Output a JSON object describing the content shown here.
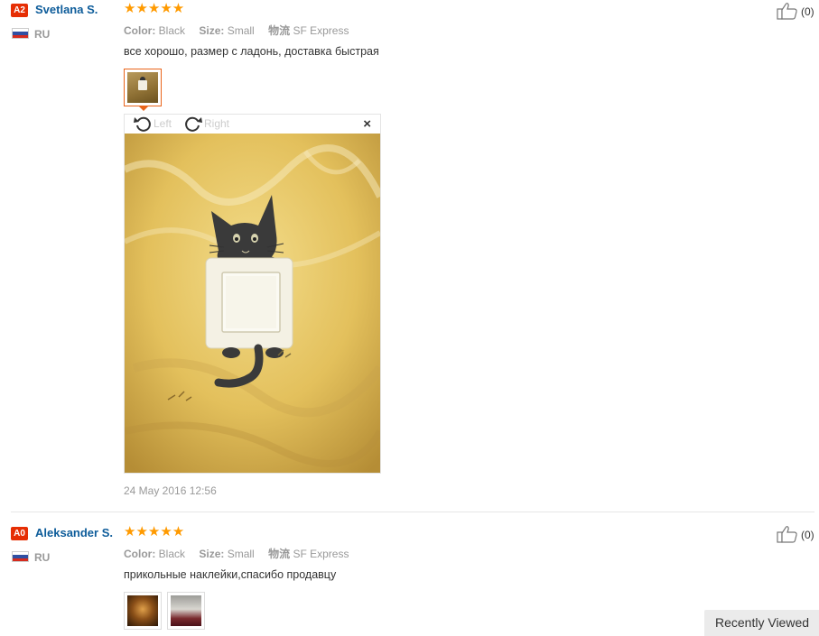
{
  "reviews": [
    {
      "level": "A2",
      "name": "Svetlana S.",
      "country": "RU",
      "stars": "★★★★★",
      "color_label": "Color:",
      "color_value": "Black",
      "size_label": "Size:",
      "size_value": "Small",
      "shipping_label": "物流",
      "shipping_value": "SF Express",
      "text": "все хорошо, размер с ладонь, доставка быстрая",
      "likes": "(0)",
      "date": "24 May 2016 12:56"
    },
    {
      "level": "A0",
      "name": "Aleksander S.",
      "country": "RU",
      "stars": "★★★★★",
      "color_label": "Color:",
      "color_value": "Black",
      "size_label": "Size:",
      "size_value": "Small",
      "shipping_label": "物流",
      "shipping_value": "SF Express",
      "text": "прикольные наклейки,спасибо продавцу",
      "likes": "(0)"
    }
  ],
  "viewer": {
    "rotate_left": "Left",
    "rotate_right": "Right",
    "close": "×"
  },
  "recently_viewed": "Recently Viewed",
  "colors": {
    "name_link": "#0d5c9a",
    "star": "#ff9a00",
    "badge": "#e62e04",
    "active_thumb": "#e9641a"
  }
}
